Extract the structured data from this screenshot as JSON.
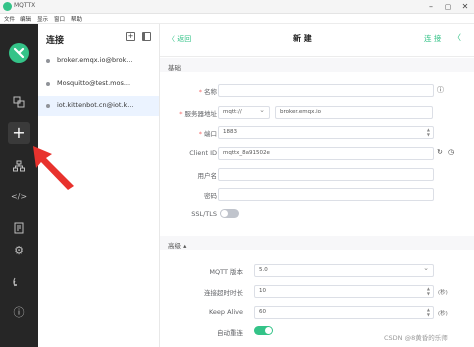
{
  "window": {
    "title": "MQTTX"
  },
  "menubar": [
    "文件",
    "编辑",
    "显示",
    "窗口",
    "帮助"
  ],
  "connections_panel": {
    "title": "连接",
    "items": [
      {
        "name": "broker.emqx.io@brok...",
        "active": false
      },
      {
        "name": "Mosquitto@test.mos...",
        "active": false
      },
      {
        "name": "iot.kittenbot.cn@iot.k...",
        "active": true
      }
    ]
  },
  "main": {
    "back": "〈 返回",
    "title": "新 建",
    "connect": "连 接",
    "basic_section": "基础",
    "advanced_section": "高级 ▴",
    "fields": {
      "name": {
        "label": "名称",
        "value": ""
      },
      "host": {
        "label": "服务器地址",
        "protocol": "mqtt://",
        "value": "broker.emqx.io"
      },
      "port": {
        "label": "端口",
        "value": "1883"
      },
      "client_id": {
        "label": "Client ID",
        "value": "mqttx_8a91502e"
      },
      "username": {
        "label": "用户名",
        "value": ""
      },
      "password": {
        "label": "密码",
        "value": ""
      },
      "ssl": {
        "label": "SSL/TLS",
        "enabled": false
      }
    },
    "advanced": {
      "mqtt_version": {
        "label": "MQTT 版本",
        "value": "5.0"
      },
      "connect_timeout": {
        "label": "连接超时时长",
        "value": "10",
        "unit": "(秒)"
      },
      "keep_alive": {
        "label": "Keep Alive",
        "value": "60",
        "unit": "(秒)"
      },
      "auto_reconnect": {
        "label": "自动重连",
        "enabled": true
      }
    }
  },
  "watermark": "CSDN @8黄昏的乐师",
  "colors": {
    "accent": "#34c388",
    "sidebar": "#262626",
    "annotation_arrow": "#e8322d"
  }
}
